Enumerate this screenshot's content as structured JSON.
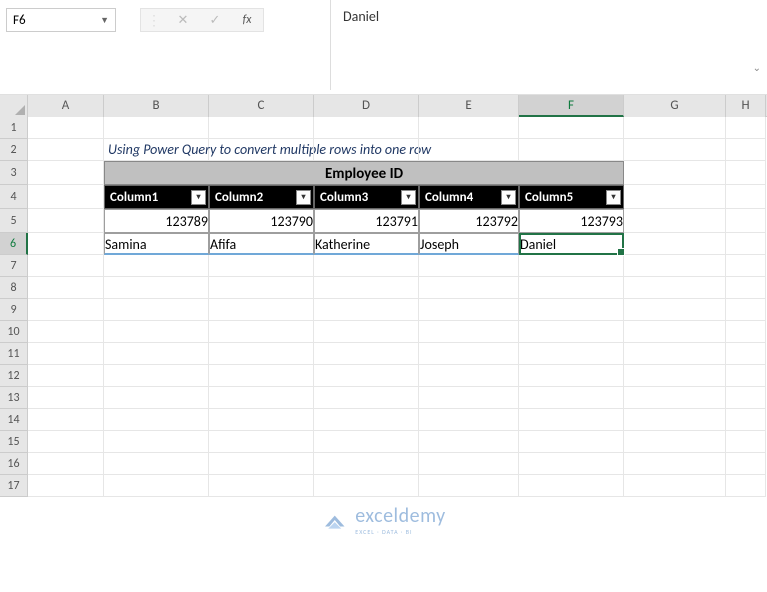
{
  "namebox": {
    "value": "F6"
  },
  "formula_bar": {
    "value": "Daniel"
  },
  "columns": [
    "A",
    "B",
    "C",
    "D",
    "E",
    "F",
    "G",
    "H"
  ],
  "selected_col": "F",
  "selected_row": 6,
  "row_numbers": [
    1,
    2,
    3,
    4,
    5,
    6,
    7,
    8,
    9,
    10,
    11,
    12,
    13,
    14,
    15,
    16,
    17
  ],
  "title": "Using Power Query to convert multiple rows into one row",
  "table": {
    "header": "Employee ID",
    "cols": [
      "Column1",
      "Column2",
      "Column3",
      "Column4",
      "Column5"
    ],
    "row1": [
      "123789",
      "123790",
      "123791",
      "123792",
      "123793"
    ],
    "row2": [
      "Samina",
      "Afifa",
      "Katherine",
      "Joseph",
      "Daniel"
    ]
  },
  "chart_data": {
    "type": "table",
    "title": "Employee ID",
    "columns": [
      "Column1",
      "Column2",
      "Column3",
      "Column4",
      "Column5"
    ],
    "rows": [
      [
        123789,
        123790,
        123791,
        123792,
        123793
      ],
      [
        "Samina",
        "Afifa",
        "Katherine",
        "Joseph",
        "Daniel"
      ]
    ]
  },
  "watermark": {
    "brand": "exceldemy",
    "tag": "EXCEL · DATA · BI"
  }
}
